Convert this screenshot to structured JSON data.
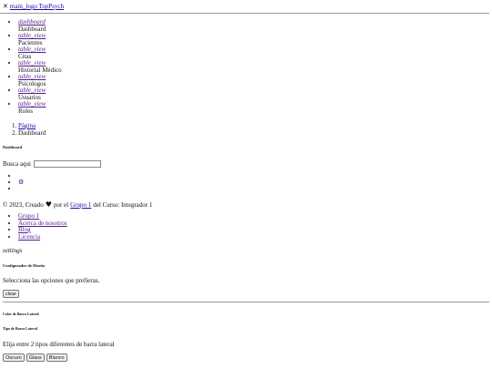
{
  "brand": {
    "close_glyph": "✕",
    "logo_alt": "main_logo",
    "name": "TopPsych"
  },
  "sidebar": {
    "items": [
      {
        "icon": "dashboard",
        "label": "Dashboard"
      },
      {
        "icon": "table_view",
        "label": "Pacientes"
      },
      {
        "icon": "table_view",
        "label": "Citas"
      },
      {
        "icon": "table_view",
        "label": "Historial Médico"
      },
      {
        "icon": "table_view",
        "label": "Psicologos"
      },
      {
        "icon": "table_view",
        "label": "Usuarios"
      },
      {
        "icon": "table_view",
        "label": "Roles"
      }
    ]
  },
  "breadcrumb": {
    "items": [
      "Página",
      "Dashboard"
    ]
  },
  "page": {
    "title": "Dashboard"
  },
  "search": {
    "label": "Busca aqui",
    "value": ""
  },
  "footer": {
    "copyright": "© 2023, Creado",
    "by": "por el",
    "group_link": "Grupo 1",
    "course": "del Curso: Integrador 1",
    "links": [
      "Grupo 1",
      "Acerca de nosotros",
      "Blog",
      "Licencia"
    ]
  },
  "config": {
    "settings_icon": "settings",
    "title": "Configurador de Diseño",
    "subtitle": "Selecciona las opciones que prefieras.",
    "clear_label": "clear",
    "sidebar_color_title": "Color de Barra Lateral",
    "sidebar_type_title": "Tipo de Barra Lateral",
    "sidebar_type_desc": "Elija entre 2 tipos diferentes de barra lateral",
    "buttons": [
      "Oscuro",
      "Glass",
      "Blanco"
    ]
  }
}
